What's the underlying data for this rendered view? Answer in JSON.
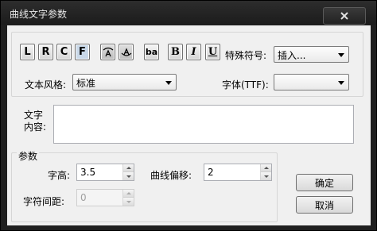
{
  "window": {
    "title": "曲线文字参数"
  },
  "toolbar": {
    "buttons": [
      {
        "label": "L"
      },
      {
        "label": "R"
      },
      {
        "label": "C"
      },
      {
        "label": "F"
      },
      {
        "label": "ba"
      },
      {
        "label": "B"
      },
      {
        "label": "I"
      },
      {
        "label": "U"
      }
    ],
    "special_symbol_label": "特殊符号:",
    "special_symbol_value": "插入..."
  },
  "style": {
    "text_style_label": "文本风格:",
    "text_style_value": "标准",
    "font_label": "字体(TTF):",
    "font_value": ""
  },
  "content": {
    "label_line1": "文字",
    "label_line2": "内容:",
    "value": ""
  },
  "params": {
    "group_label": "参数",
    "height_label": "字高:",
    "height_value": "3.5",
    "offset_label": "曲线偏移:",
    "offset_value": "2",
    "spacing_label": "字符间距:",
    "spacing_value": "0"
  },
  "actions": {
    "ok_label": "确定",
    "cancel_label": "取消"
  }
}
